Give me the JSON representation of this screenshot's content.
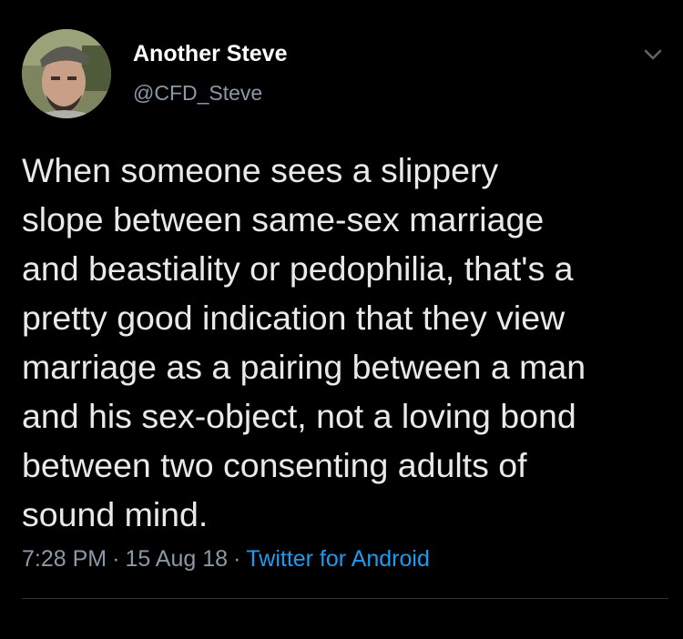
{
  "tweet": {
    "author": {
      "display_name": "Another Steve",
      "handle": "@CFD_Steve"
    },
    "text_lines": [
      "When someone sees a slippery",
      "slope between same-sex marriage",
      "and beastiality or pedophilia, that's a",
      "pretty good indication that they view",
      "marriage as a pairing between a man",
      "and his sex-object, not a loving bond",
      "between two consenting adults of",
      "sound mind."
    ],
    "meta": {
      "time": "7:28 PM",
      "separator": "·",
      "date": "15 Aug 18",
      "source": "Twitter for Android"
    },
    "icons": {
      "menu": "chevron-down-icon"
    },
    "colors": {
      "background": "#000000",
      "text": "#e7e9ea",
      "secondary": "#8b98a5",
      "link": "#1d9bf0",
      "divider": "#2f3336"
    }
  }
}
